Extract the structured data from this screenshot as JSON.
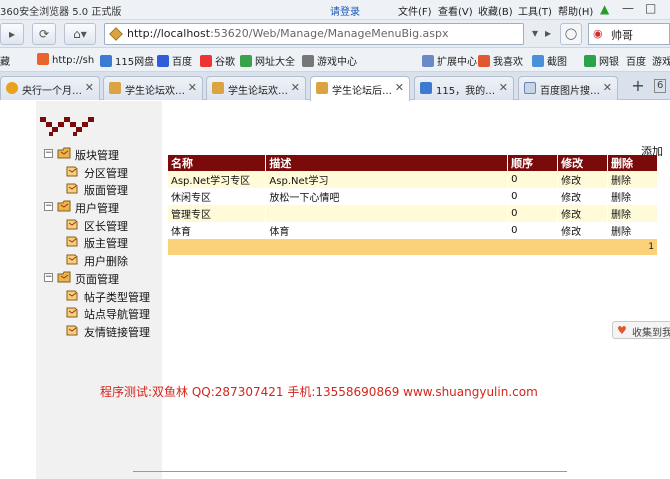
{
  "browser": {
    "title": "360安全浏览器 5.0 正式版",
    "login": "请登录",
    "menus": [
      "文件(F)",
      "查看(V)",
      "收藏(B)",
      "工具(T)",
      "帮助(H)"
    ],
    "url_host": "http://localhost",
    "url_rest": ":53620/Web/Manage/ManageMenuBig.aspx",
    "search_text": "帅哥",
    "favorites": [
      "藏",
      "http://sh",
      "115网盘",
      "百度",
      "谷歌",
      "网址大全",
      "游戏中心",
      "扩展中心",
      "我喜欢",
      "截图",
      "网银",
      "百度",
      "游戏"
    ],
    "tabs": [
      {
        "label": "央行一个月…",
        "active": false
      },
      {
        "label": "学生论坛欢…",
        "active": false
      },
      {
        "label": "学生论坛欢…",
        "active": false
      },
      {
        "label": "学生论坛后…",
        "active": true
      },
      {
        "label": "115，我的…",
        "active": false
      },
      {
        "label": "百度图片搜…",
        "active": false
      }
    ],
    "tab_count": "6"
  },
  "sidebar": {
    "groups": [
      {
        "label": "版块管理",
        "items": [
          "分区管理",
          "版面管理"
        ]
      },
      {
        "label": "用户管理",
        "items": [
          "区长管理",
          "版主管理",
          "用户删除"
        ]
      },
      {
        "label": "页面管理",
        "items": [
          "帖子类型管理",
          "站点导航管理",
          "友情链接管理"
        ]
      }
    ]
  },
  "main": {
    "add_label": "添加",
    "columns": [
      "名称",
      "描述",
      "顺序",
      "修改",
      "删除"
    ],
    "rows": [
      [
        "Asp.Net学习专区",
        "Asp.Net学习",
        "0",
        "修改",
        "删除"
      ],
      [
        "休闲专区",
        "放松一下心情吧",
        "0",
        "修改",
        "删除"
      ],
      [
        "管理专区",
        "",
        "0",
        "修改",
        "删除"
      ],
      [
        "体育",
        "体育",
        "0",
        "修改",
        "删除"
      ]
    ],
    "page_number": "1",
    "collect_label": "收集到我",
    "footer": "程序测试:双鱼林 QQ:287307421 手机:13558690869 www.shuangyulin.com"
  },
  "colors": {
    "header_bg": "#7b0a0a",
    "row_alt": "#fffbd9",
    "pager_bg": "#fbd27a",
    "footer_text": "#d2261c"
  }
}
